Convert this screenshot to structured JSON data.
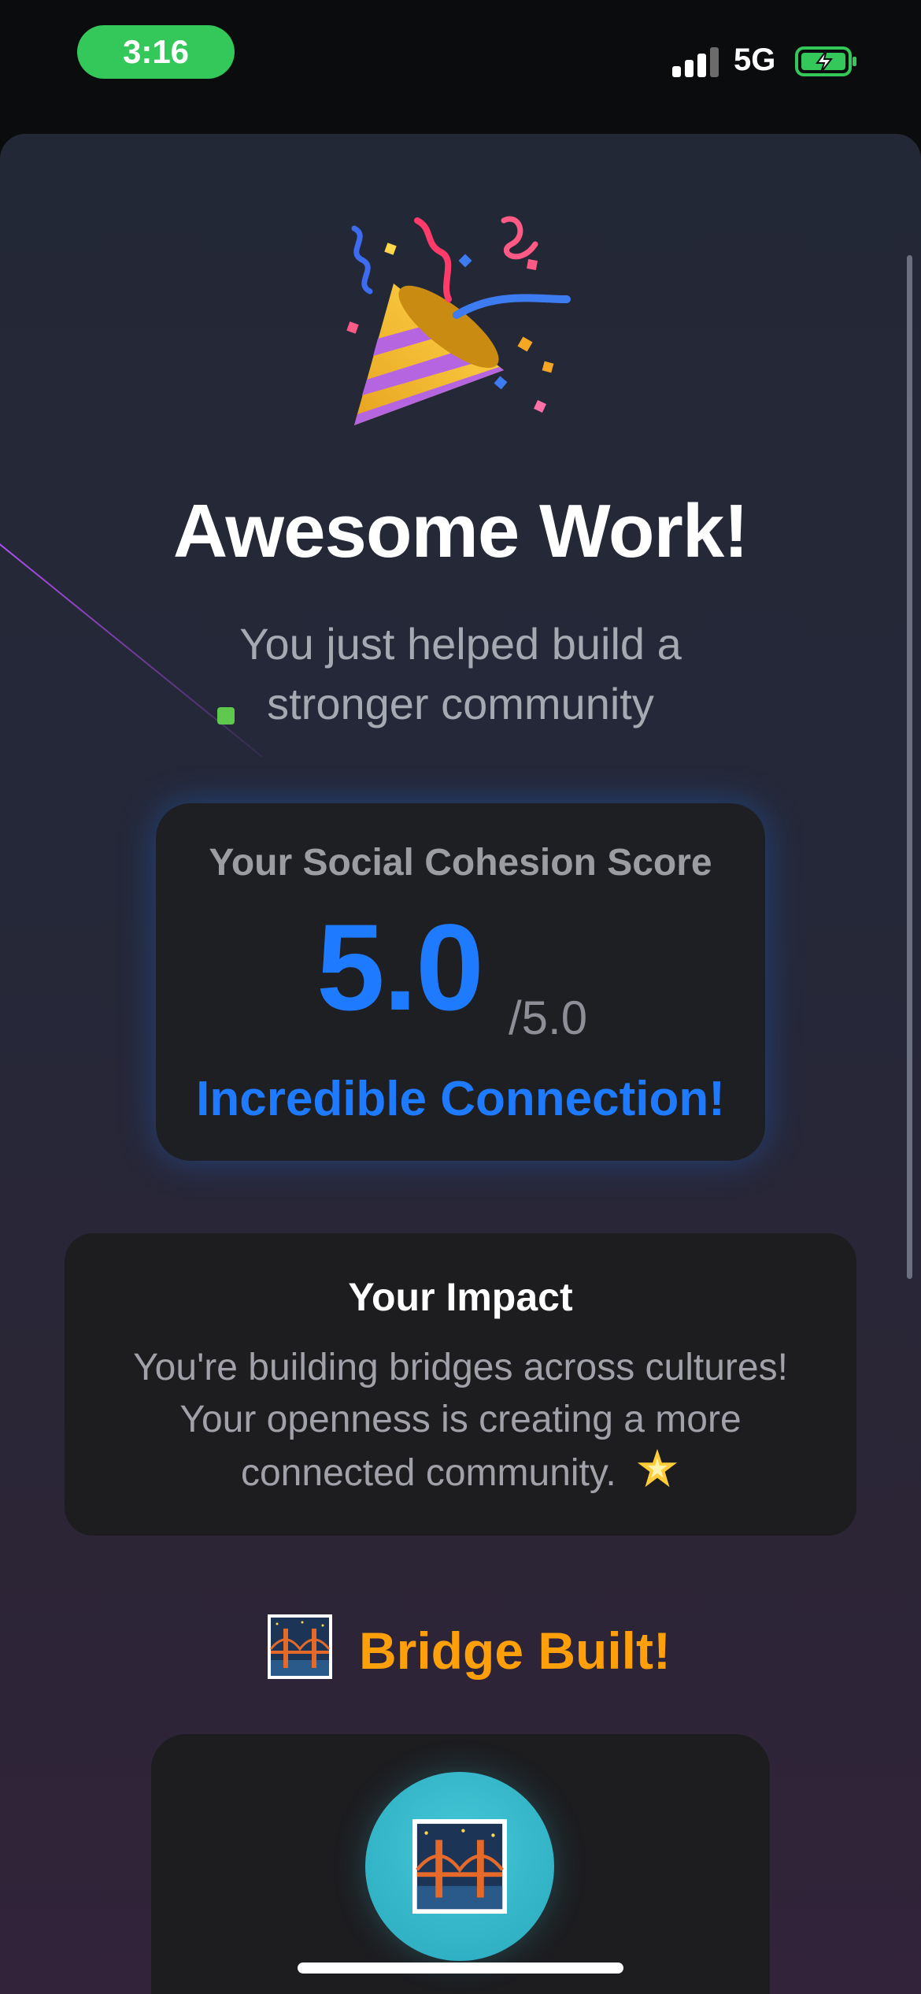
{
  "status_bar": {
    "time": "3:16",
    "network": "5G"
  },
  "celebration": {
    "headline": "Awesome Work!",
    "subtitle": "You just helped build a stronger community"
  },
  "score_card": {
    "label": "Your Social Cohesion Score",
    "value": "5.0",
    "max": "/5.0",
    "tagline": "Incredible Connection!"
  },
  "impact": {
    "title": "Your Impact",
    "text": "You're building bridges across cultures! Your openness is creating a more connected community."
  },
  "achievement": {
    "title": "Bridge Built!"
  },
  "colors": {
    "accent_blue": "#1e7bff",
    "achievement_orange": "#ff9f0a",
    "status_green": "#34c759",
    "bridge_teal": "#38b9cb"
  },
  "icons": [
    "party-popper-icon",
    "glowing-star-icon",
    "bridge-at-night-icon",
    "cellular-signal-icon",
    "battery-charging-icon"
  ]
}
